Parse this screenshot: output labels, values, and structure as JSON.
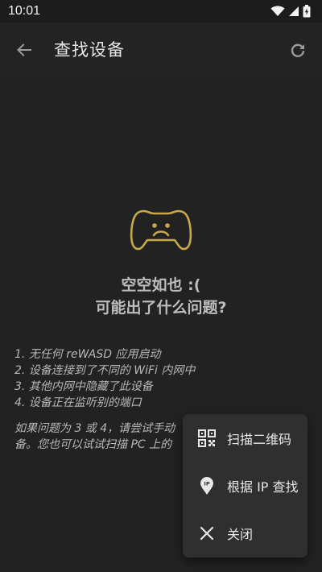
{
  "status_bar": {
    "time": "10:01"
  },
  "app_bar": {
    "title": "查找设备"
  },
  "empty_state": {
    "title": "空空如也 :(",
    "subtitle": "可能出了什么问题?"
  },
  "reasons": [
    "1. 无任何 reWASD 应用启动",
    "2. 设备连接到了不同的 WiFi 内网中",
    "3. 其他内网中隐藏了此设备",
    "4. 设备正在监听别的端口"
  ],
  "hint": {
    "line1": "如果问题为 3 或 4，请尝试手动",
    "line2": "备。您也可以试试扫描 PC 上的"
  },
  "menu": {
    "items": [
      {
        "label": "扫描二维码",
        "icon": "qr-code-icon"
      },
      {
        "label": "根据 IP 查找",
        "icon": "ip-location-icon"
      },
      {
        "label": "关闭",
        "icon": "close-icon"
      }
    ]
  },
  "colors": {
    "background": "#222222",
    "accent_gold": "#c9a84c",
    "menu_bg": "#2f2f2f"
  }
}
